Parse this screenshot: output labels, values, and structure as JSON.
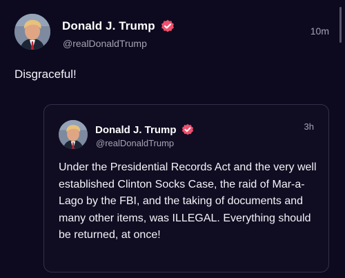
{
  "post": {
    "author": {
      "display_name": "Donald J. Trump",
      "handle": "@realDonaldTrump",
      "verified": true
    },
    "time": "10m",
    "text": "Disgraceful!"
  },
  "quoted_post": {
    "author": {
      "display_name": "Donald J. Trump",
      "handle": "@realDonaldTrump",
      "verified": true
    },
    "time": "3h",
    "text": "Under the Presidential Records Act and the very well established Clinton Socks Case, the raid of Mar-a-Lago by the FBI, and the taking of documents and many other items, was ILLEGAL. Everything should be returned, at once!"
  },
  "icons": {
    "verified": "verified-badge-icon",
    "avatar": "profile-photo"
  },
  "colors": {
    "background": "#0d0a1f",
    "verified_badge": "#ef4f6d",
    "secondary_text": "#a7a3b5",
    "quote_border": "#34304a"
  }
}
